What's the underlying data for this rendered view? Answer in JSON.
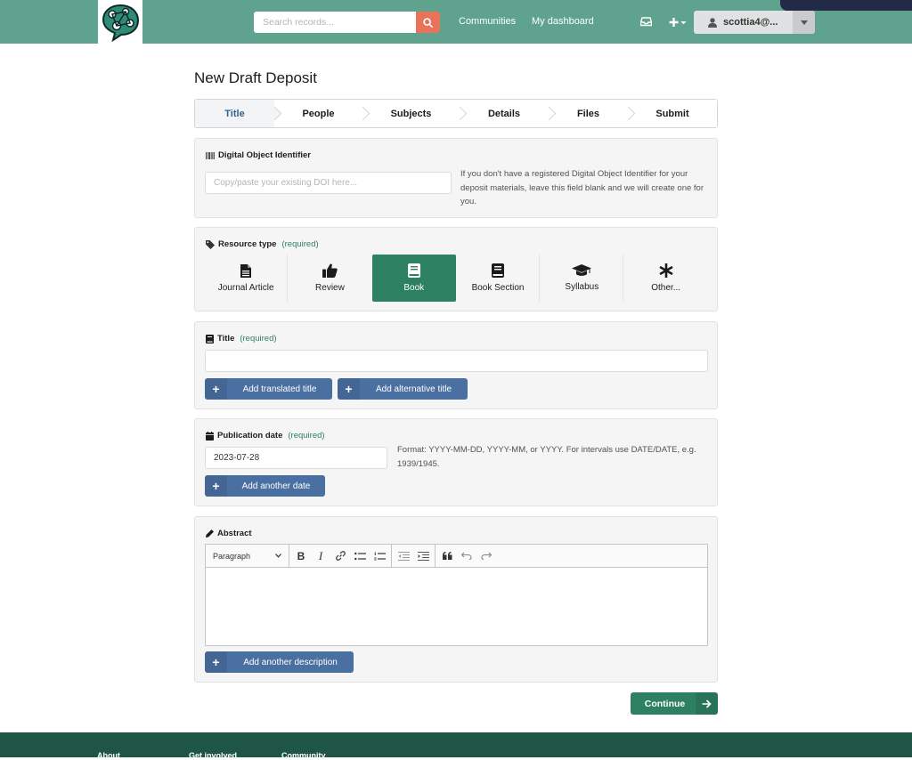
{
  "header": {
    "search_placeholder": "Search records...",
    "nav": [
      "Communities",
      "My dashboard"
    ],
    "user_name": "scottia4@...",
    "colors": {
      "bar": "#5fa28d",
      "search_button": "#e8735a"
    }
  },
  "page": {
    "title": "New Draft Deposit"
  },
  "steps": [
    {
      "label": "Title",
      "active": true
    },
    {
      "label": "People",
      "active": false
    },
    {
      "label": "Subjects",
      "active": false
    },
    {
      "label": "Details",
      "active": false
    },
    {
      "label": "Files",
      "active": false
    },
    {
      "label": "Submit",
      "active": false
    }
  ],
  "doi": {
    "label": "Digital Object Identifier",
    "placeholder": "Copy/paste your existing DOI here...",
    "help": "If you don't have a registered Digital Object Identifier for your deposit materials, leave this field blank and we will create one for you."
  },
  "resource_type": {
    "label": "Resource type",
    "required": "(required)",
    "options": [
      {
        "label": "Journal Article",
        "icon": "file-icon",
        "selected": false
      },
      {
        "label": "Review",
        "icon": "thumbs-up-icon",
        "selected": false
      },
      {
        "label": "Book",
        "icon": "book-icon",
        "selected": true
      },
      {
        "label": "Book Section",
        "icon": "book-section-icon",
        "selected": false
      },
      {
        "label": "Syllabus",
        "icon": "graduation-cap-icon",
        "selected": false
      },
      {
        "label": "Other...",
        "icon": "asterisk-icon",
        "selected": false
      }
    ]
  },
  "title_field": {
    "label": "Title",
    "required": "(required)",
    "value": "",
    "add_translated": "Add translated title",
    "add_alternative": "Add alternative title"
  },
  "publication_date": {
    "label": "Publication date",
    "required": "(required)",
    "value": "2023-07-28",
    "help": "Format: YYYY-MM-DD, YYYY-MM, or YYYY. For intervals use DATE/DATE, e.g. 1939/1945.",
    "add_another": "Add another date"
  },
  "abstract": {
    "label": "Abstract",
    "paragraph_select": "Paragraph",
    "add_another": "Add another description"
  },
  "continue_label": "Continue",
  "footer": [
    "About",
    "Get involved",
    "Community"
  ]
}
